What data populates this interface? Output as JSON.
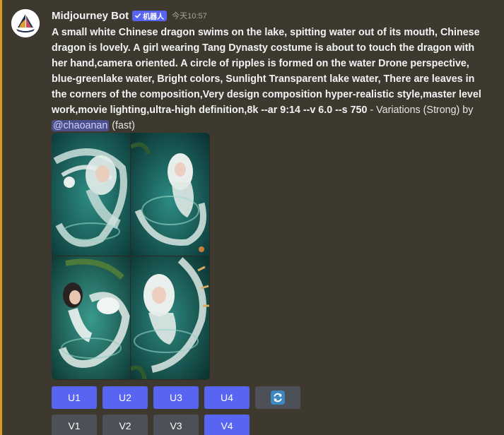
{
  "message": {
    "username": "Midjourney Bot",
    "badge_label": "机器人",
    "timestamp": "今天10:57",
    "prompt_bold": "A small white Chinese dragon swims on the lake, spitting water out of its mouth, Chinese dragon is lovely. A girl wearing Tang Dynasty costume is about to touch the dragon with her hand,camera oriented. A circle of ripples is formed on the water Drone perspective, blue-greenlake water, Bright colors, Sunlight Transparent lake water, There are leaves in the corners of the composition,Very design composition hyper-realistic style,master level work,movie lighting,ultra-high definition,8k --ar 9:14 --v 6.0 --s 750",
    "prompt_suffix": " - Variations (Strong) by ",
    "mention": "@chaoanan",
    "speed": " (fast)"
  },
  "images": [
    {
      "icon": "dragon-girl-image-1"
    },
    {
      "icon": "dragon-girl-image-2"
    },
    {
      "icon": "dragon-girl-image-3"
    },
    {
      "icon": "dragon-girl-image-4"
    }
  ],
  "buttons": {
    "upscale": [
      "U1",
      "U2",
      "U3",
      "U4"
    ],
    "reroll_icon": "refresh-icon",
    "variation": [
      "V1",
      "V2",
      "V3",
      "V4"
    ]
  },
  "colors": {
    "background": "#3d392f",
    "highlight_bar": "#d89a1f",
    "blurple": "#5865f2",
    "secondary_button": "#4e5058",
    "mention_bg": "#4c4f8a"
  }
}
